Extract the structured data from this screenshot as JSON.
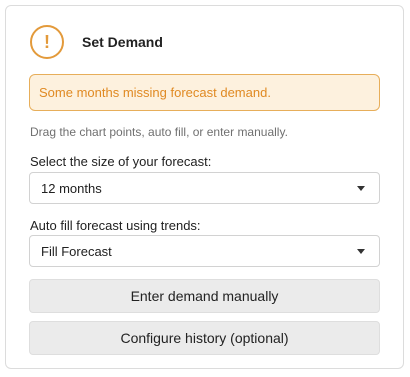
{
  "panel": {
    "title": "Set Demand",
    "warning_icon_glyph": "!",
    "alert_text": "Some months missing forecast demand.",
    "hint_text": "Drag the chart points, auto fill, or enter manually.",
    "forecast_size": {
      "label": "Select the size of your forecast:",
      "selected": "12 months"
    },
    "auto_fill": {
      "label": "Auto fill forecast using trends:",
      "selected": "Fill Forecast"
    },
    "buttons": {
      "enter_manual": "Enter demand manually",
      "configure_history": "Configure history (optional)"
    }
  },
  "colors": {
    "warning": "#e39a3b",
    "alert_bg": "#fdf1de",
    "alert_text": "#e08a23",
    "button_bg": "#ebebeb"
  }
}
